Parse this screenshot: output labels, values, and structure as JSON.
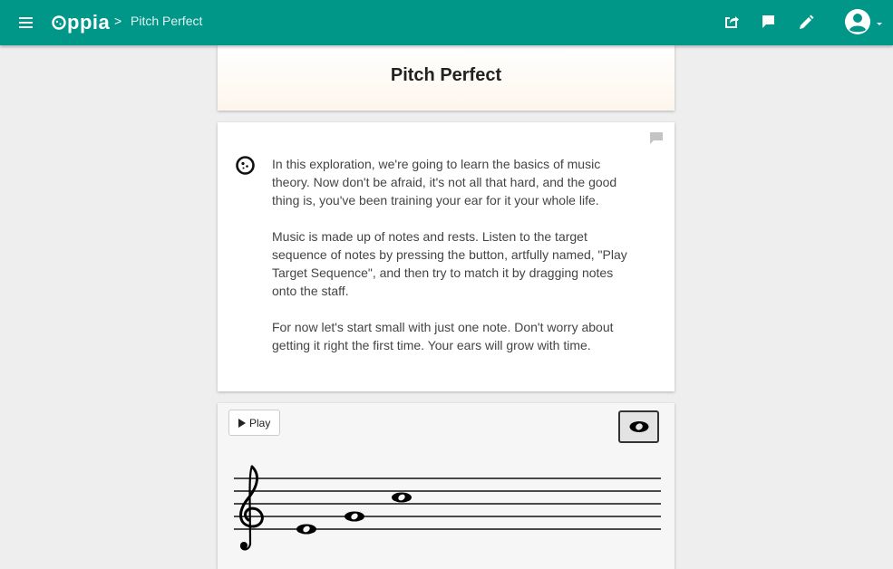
{
  "navbar": {
    "logo_text": "ppia",
    "separator": ">",
    "exploration_title": "Pitch Perfect",
    "icons": [
      "share-icon",
      "feedback-icon",
      "edit-icon",
      "account-icon"
    ],
    "accent_color": "#009688"
  },
  "title_card": {
    "title": "Pitch Perfect"
  },
  "content": {
    "paragraphs": [
      "In this exploration, we're going to learn the basics of music theory. Now don't be afraid, it's not all that hard, and the good thing is, you've been training your ear for it your whole life.",
      "Music is made up of notes and rests. Listen to the target sequence of notes by pressing the button, artfully named, \"Play Target Sequence\", and then try to match it by dragging notes onto the staff.",
      "For now let's start small with just one note. Don't worry about getting it right the first time. Your ears will grow with time."
    ]
  },
  "interaction": {
    "play_label": "Play",
    "clef": "treble",
    "staff_note_count": 3,
    "palette_note": "whole-note"
  }
}
